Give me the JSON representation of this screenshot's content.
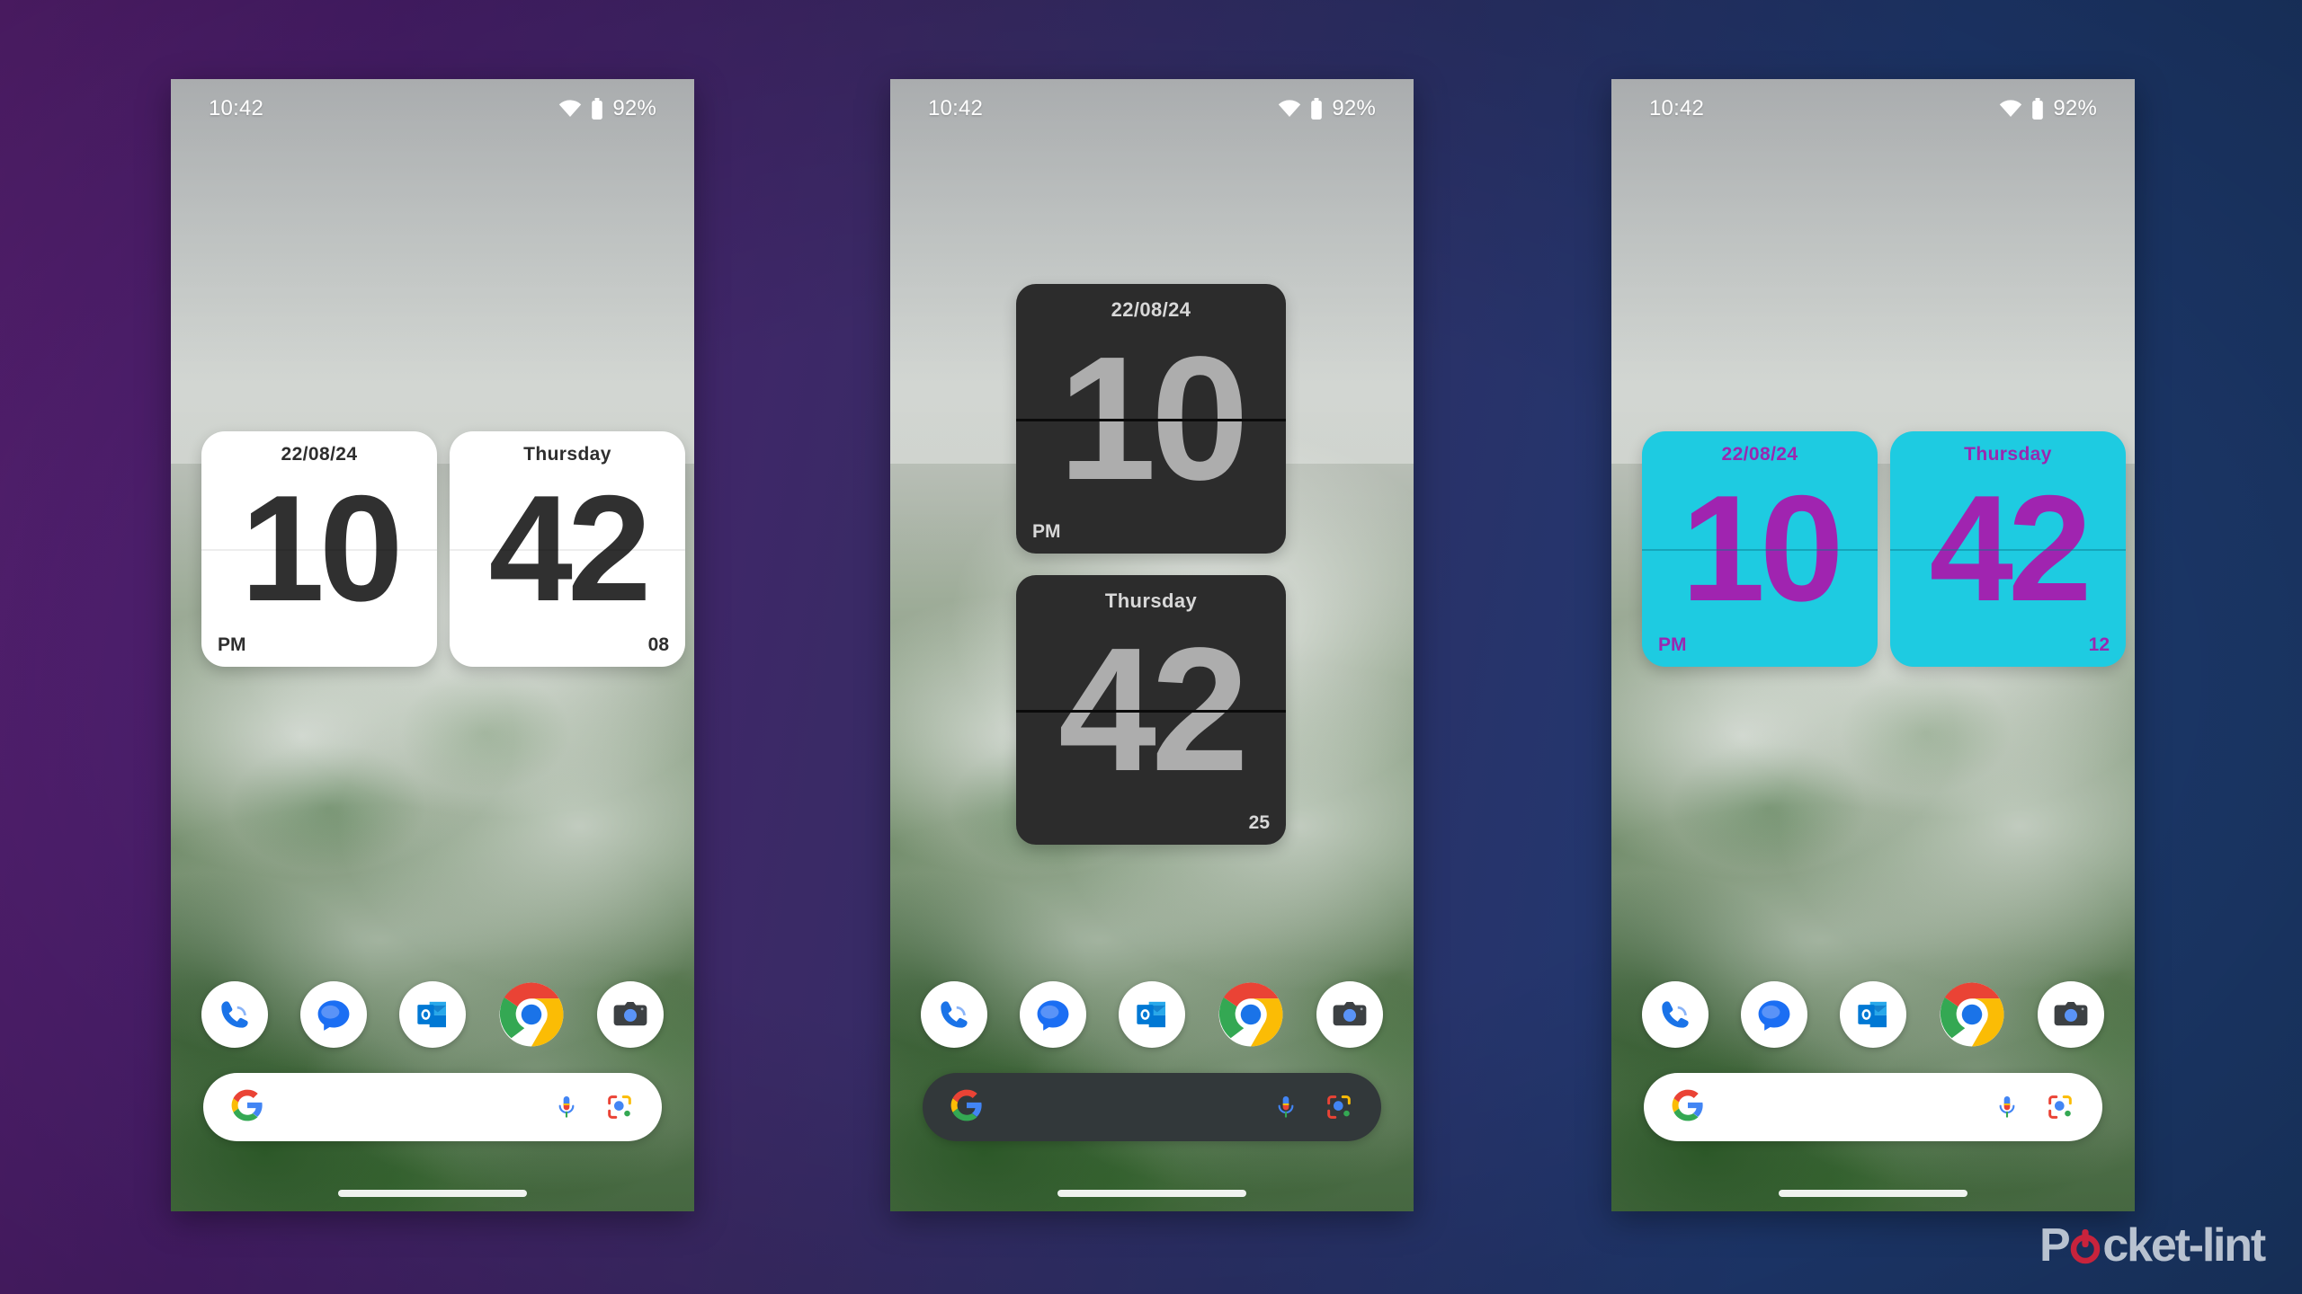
{
  "backdrop": {
    "gradient_left": "#4a1f6e",
    "gradient_right": "#1b3a6b"
  },
  "brand": {
    "name": "Pocket-lint",
    "part_a": "P",
    "part_b": "cket-lint",
    "text_color": "#b8c2d0",
    "accent_color": "#c8233c",
    "power_icon": "power-icon"
  },
  "status_bar": {
    "time": "10:42",
    "wifi_icon": "wifi-icon",
    "battery_icon": "battery-icon",
    "battery_percent": "92%"
  },
  "dock": {
    "items": [
      {
        "name": "phone",
        "label": "Phone",
        "icon": "phone-icon"
      },
      {
        "name": "messages",
        "label": "Messages",
        "icon": "messages-icon"
      },
      {
        "name": "outlook",
        "label": "Outlook",
        "icon": "outlook-icon"
      },
      {
        "name": "chrome",
        "label": "Chrome",
        "icon": "chrome-icon"
      },
      {
        "name": "camera",
        "label": "Camera",
        "icon": "camera-icon"
      }
    ]
  },
  "search": {
    "placeholder": "",
    "value": "",
    "google_icon": "google-g-icon",
    "mic_icon": "microphone-icon",
    "lens_icon": "google-lens-icon"
  },
  "phones": [
    {
      "id": "phone-1",
      "theme": "white",
      "theme_label": "Light flip clock widget",
      "background_color": "#ffffff",
      "text_color": "#303030",
      "search_theme": "light",
      "cards": [
        {
          "top_label": "22/08/24",
          "digits": "10",
          "bottom_left": "PM",
          "bottom_right": ""
        },
        {
          "top_label": "Thursday",
          "digits": "42",
          "bottom_left": "",
          "bottom_right": "08"
        }
      ]
    },
    {
      "id": "phone-2",
      "theme": "dark",
      "theme_label": "Dark flip clock widget",
      "background_color": "#2c2c2c",
      "text_color": "#adadad",
      "search_theme": "dark",
      "cards": [
        {
          "top_label": "22/08/24",
          "digits": "10",
          "bottom_left": "PM",
          "bottom_right": ""
        },
        {
          "top_label": "Thursday",
          "digits": "42",
          "bottom_left": "",
          "bottom_right": "25"
        }
      ]
    },
    {
      "id": "phone-3",
      "theme": "cyan",
      "theme_label": "Cyan flip clock widget",
      "background_color": "#1ecbe1",
      "text_color": "#a024b0",
      "search_theme": "light",
      "cards": [
        {
          "top_label": "22/08/24",
          "digits": "10",
          "bottom_left": "PM",
          "bottom_right": ""
        },
        {
          "top_label": "Thursday",
          "digits": "42",
          "bottom_left": "",
          "bottom_right": "12"
        }
      ]
    }
  ]
}
